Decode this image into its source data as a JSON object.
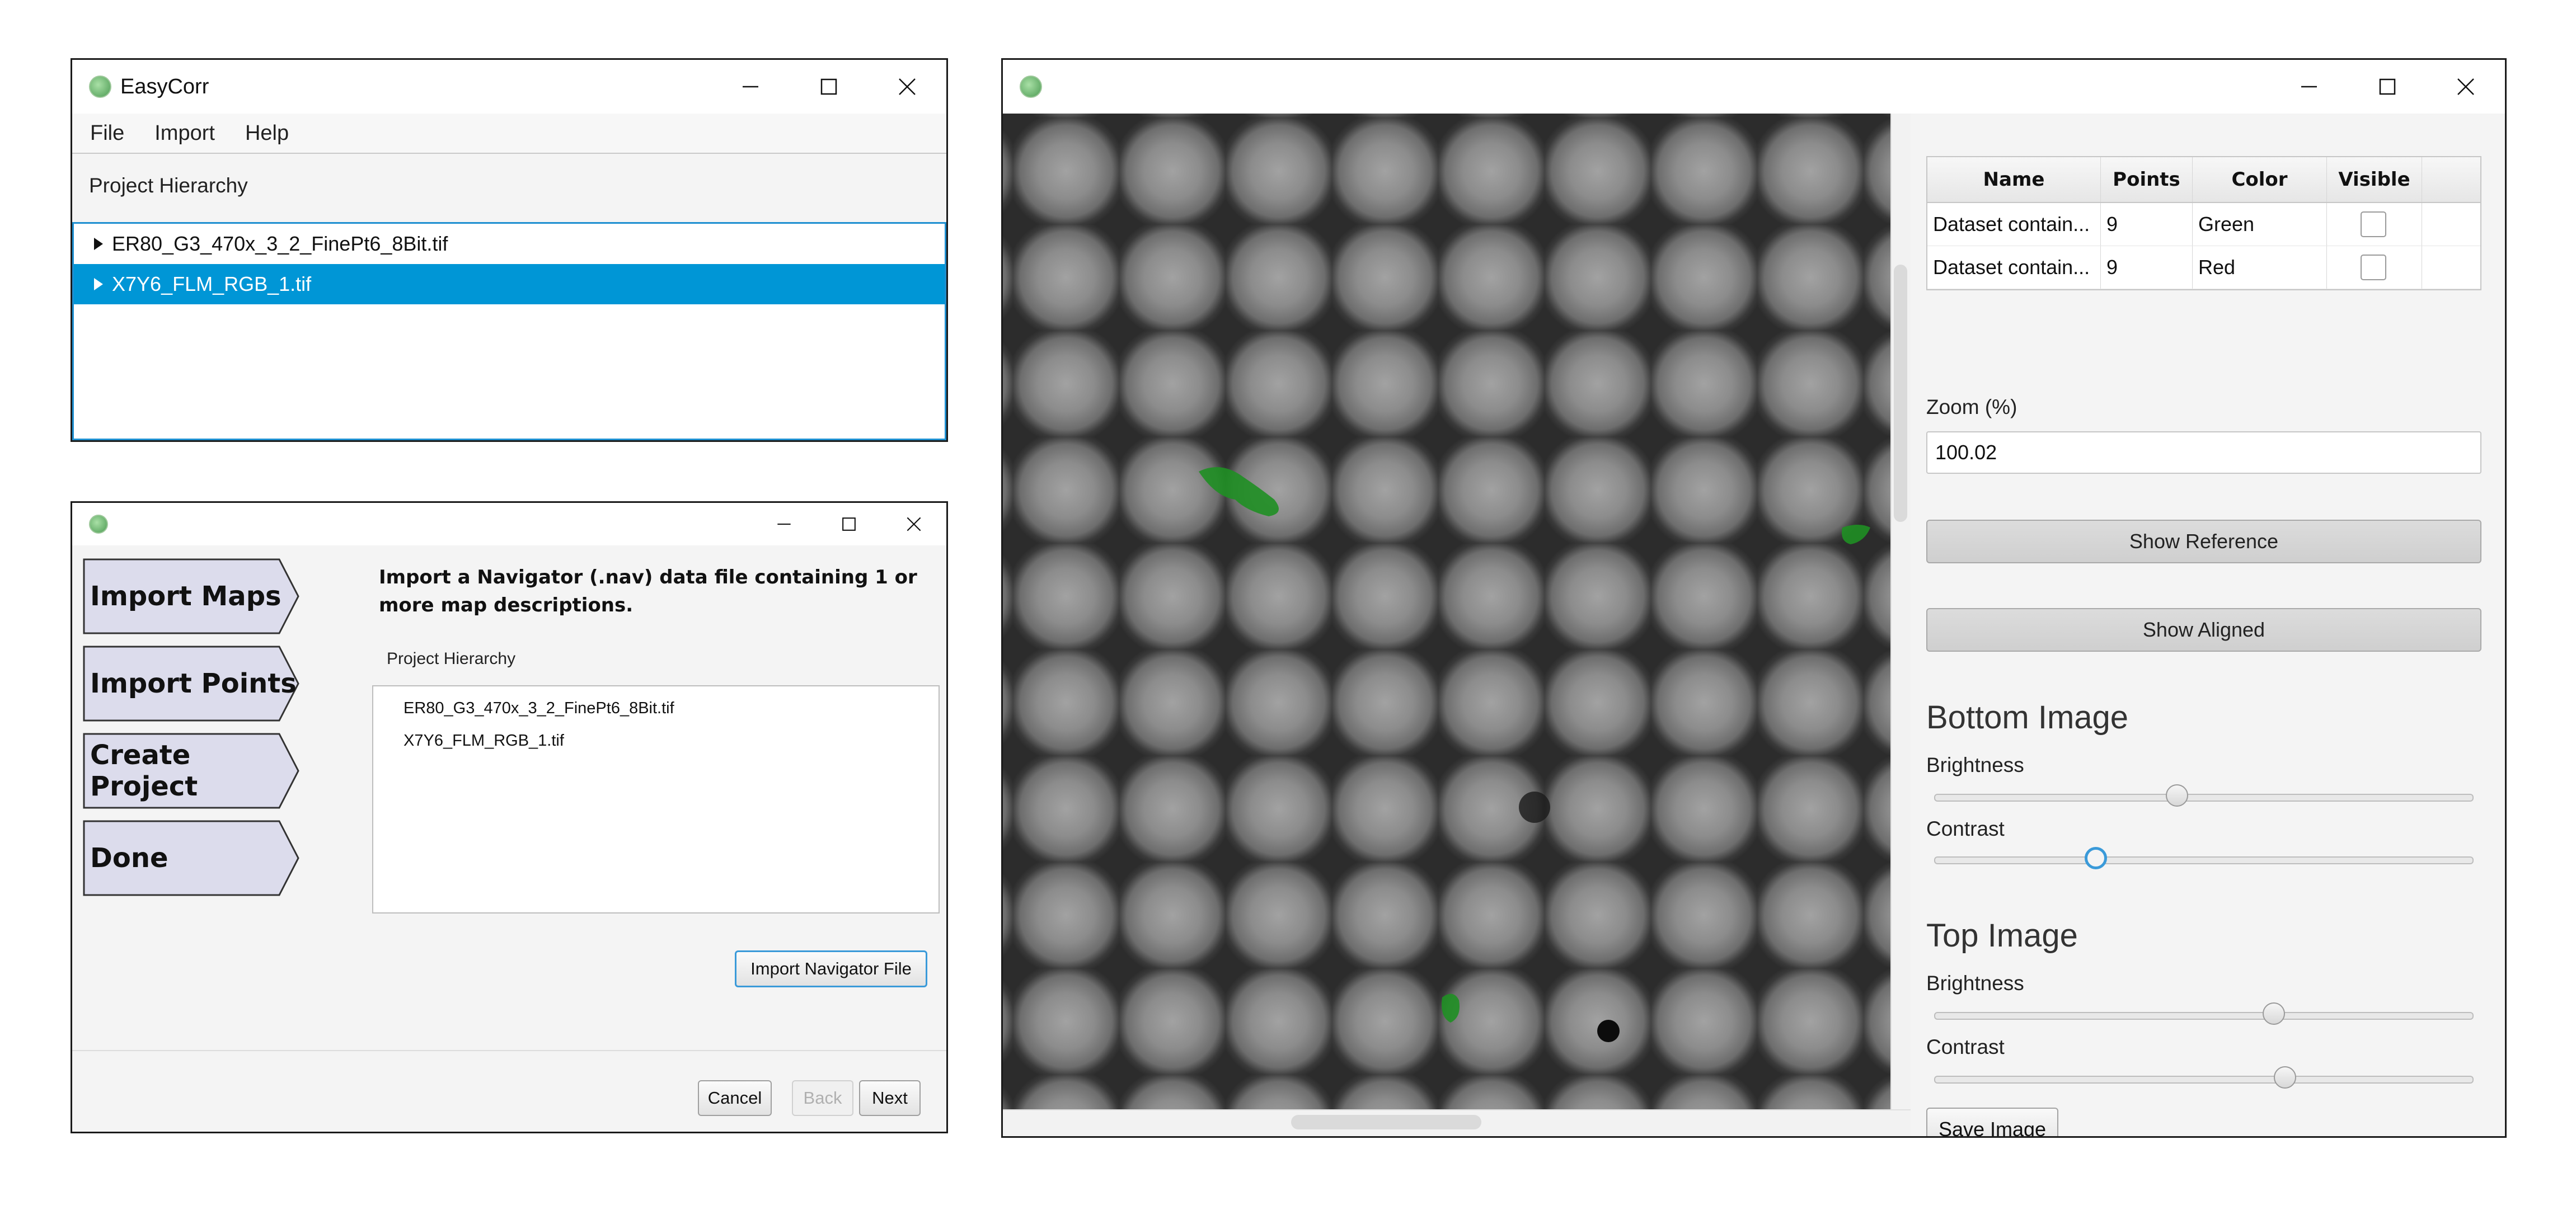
{
  "main_window": {
    "title": "EasyCorr",
    "menu": [
      "File",
      "Import",
      "Help"
    ],
    "section_label": "Project Hierarchy",
    "tree_items": [
      {
        "label": "ER80_G3_470x_3_2_FinePt6_8Bit.tif",
        "selected": false
      },
      {
        "label": "X7Y6_FLM_RGB_1.tif",
        "selected": true
      }
    ]
  },
  "wizard_window": {
    "title": "",
    "steps": [
      "Import Maps",
      "Import Points",
      "Create Project",
      "Done"
    ],
    "instruction": "Import a Navigator (.nav) data file containing 1 or more map descriptions.",
    "hierarchy_label": "Project Hierarchy",
    "hierarchy_items": [
      "ER80_G3_470x_3_2_FinePt6_8Bit.tif",
      "X7Y6_FLM_RGB_1.tif"
    ],
    "import_button": "Import Navigator File",
    "cancel_button": "Cancel",
    "back_button": "Back",
    "next_button": "Next"
  },
  "viewer_window": {
    "title": "",
    "table": {
      "headers": [
        "Name",
        "Points",
        "Color",
        "Visible"
      ],
      "rows": [
        {
          "name": "Dataset contain...",
          "points": "9",
          "color": "Green",
          "visible": false
        },
        {
          "name": "Dataset contain...",
          "points": "9",
          "color": "Red",
          "visible": false
        }
      ]
    },
    "zoom_label": "Zoom (%)",
    "zoom_value": "100.02",
    "show_reference_button": "Show Reference",
    "show_aligned_button": "Show Aligned",
    "bottom_image": {
      "heading": "Bottom Image",
      "brightness_label": "Brightness",
      "brightness_value": 0.45,
      "contrast_label": "Contrast",
      "contrast_value": 0.3
    },
    "top_image": {
      "heading": "Top Image",
      "brightness_label": "Brightness",
      "brightness_value": 0.63,
      "contrast_label": "Contrast",
      "contrast_value": 0.65
    },
    "save_button": "Save Image"
  },
  "icons": {
    "app": "app-logo-icon",
    "minimize": "minimize-icon",
    "maximize": "maximize-icon",
    "close": "close-icon",
    "tree_expand": "triangle-right-icon"
  },
  "colors": {
    "selection": "#0096d6",
    "focus": "#3a9ad9",
    "step_fill": "#dcdcec",
    "overlay_green": "#1f8f24"
  }
}
